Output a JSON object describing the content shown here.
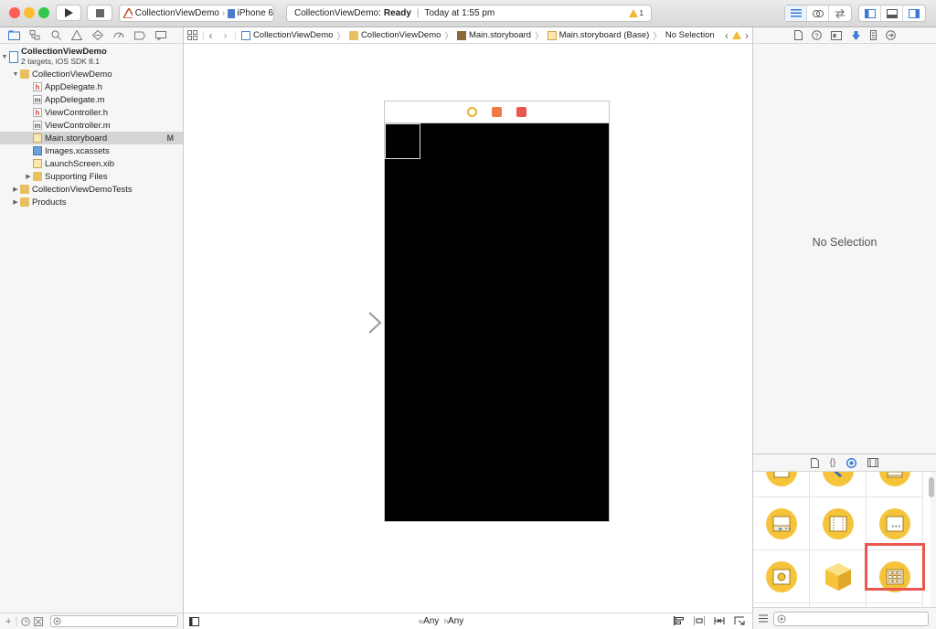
{
  "toolbar": {
    "traffic_colors": {
      "close": "#fc5d57",
      "minimize": "#fdbc2f",
      "zoom": "#34c84a"
    },
    "scheme_name": "CollectionViewDemo",
    "device_name": "iPhone 6",
    "status_project": "CollectionViewDemo:",
    "status_state": "Ready",
    "status_time": "Today at 1:55 pm",
    "warning_count": "1"
  },
  "navigator": {
    "project_name": "CollectionViewDemo",
    "project_subtitle": "2 targets, iOS SDK 8.1",
    "items": [
      {
        "label": "CollectionViewDemo",
        "kind": "folder",
        "depth": 1,
        "expanded": true
      },
      {
        "label": "AppDelegate.h",
        "kind": "h",
        "depth": 2
      },
      {
        "label": "AppDelegate.m",
        "kind": "m",
        "depth": 2
      },
      {
        "label": "ViewController.h",
        "kind": "h",
        "depth": 2
      },
      {
        "label": "ViewController.m",
        "kind": "m",
        "depth": 2
      },
      {
        "label": "Main.storyboard",
        "kind": "storyboard",
        "depth": 2,
        "badge": "M",
        "selected": true
      },
      {
        "label": "Images.xcassets",
        "kind": "assets",
        "depth": 2
      },
      {
        "label": "LaunchScreen.xib",
        "kind": "storyboard",
        "depth": 2
      },
      {
        "label": "Supporting Files",
        "kind": "folder",
        "depth": 2,
        "expanded": false
      },
      {
        "label": "CollectionViewDemoTests",
        "kind": "folder",
        "depth": 1,
        "expanded": false
      },
      {
        "label": "Products",
        "kind": "folder",
        "depth": 1,
        "expanded": false
      }
    ]
  },
  "jumpbar": {
    "crumbs": [
      "CollectionViewDemo",
      "CollectionViewDemo",
      "Main.storyboard",
      "Main.storyboard (Base)",
      "No Selection"
    ]
  },
  "editor": {
    "size_w_prefix": "w",
    "size_w_value": "Any",
    "size_h_prefix": "h",
    "size_h_value": "Any"
  },
  "inspector": {
    "empty_label": "No Selection"
  }
}
